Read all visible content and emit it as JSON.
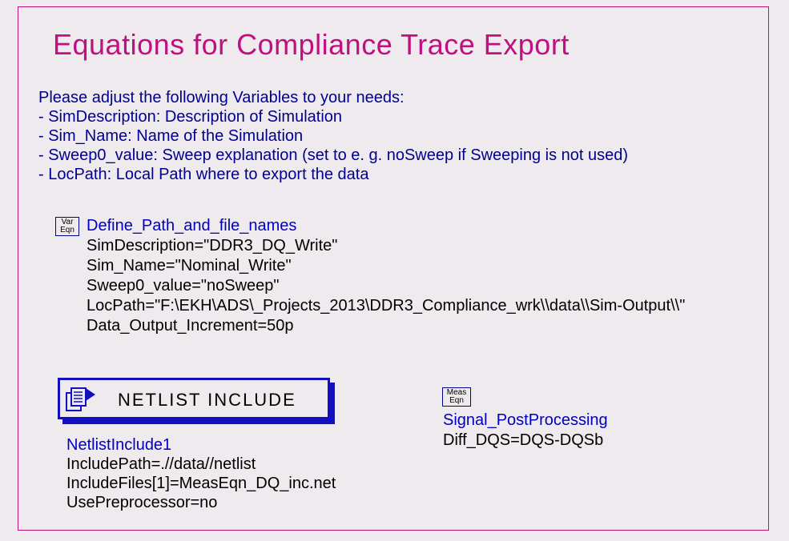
{
  "title": "Equations for Compliance Trace Export",
  "intro": {
    "line1": "Please adjust the following Variables to your needs:",
    "line2": "- SimDescription: Description of Simulation",
    "line3": "- Sim_Name: Name of the Simulation",
    "line4": "- Sweep0_value: Sweep explanation (set to e. g. noSweep if Sweeping is not used)",
    "line5": "- LocPath: Local Path where to export the data"
  },
  "var_eqn": {
    "box_line1": "Var",
    "box_line2": "Eqn",
    "header": "Define_Path_and_file_names",
    "lines": [
      "SimDescription=\"DDR3_DQ_Write\"",
      "Sim_Name=\"Nominal_Write\"",
      "Sweep0_value=\"noSweep\"",
      "LocPath=\"F:\\EKH\\ADS\\_Projects_2013\\DDR3_Compliance_wrk\\\\data\\\\Sim-Output\\\\\"",
      "Data_Output_Increment=50p"
    ]
  },
  "netlist": {
    "box_label": "NETLIST  INCLUDE",
    "header": "NetlistInclude1",
    "lines": [
      "IncludePath=.//data//netlist",
      "IncludeFiles[1]=MeasEqn_DQ_inc.net",
      "UsePreprocessor=no"
    ]
  },
  "meas_eqn": {
    "box_line1": "Meas",
    "box_line2": "Eqn",
    "header": "Signal_PostProcessing",
    "lines": [
      "Diff_DQS=DQS-DQSb"
    ]
  }
}
